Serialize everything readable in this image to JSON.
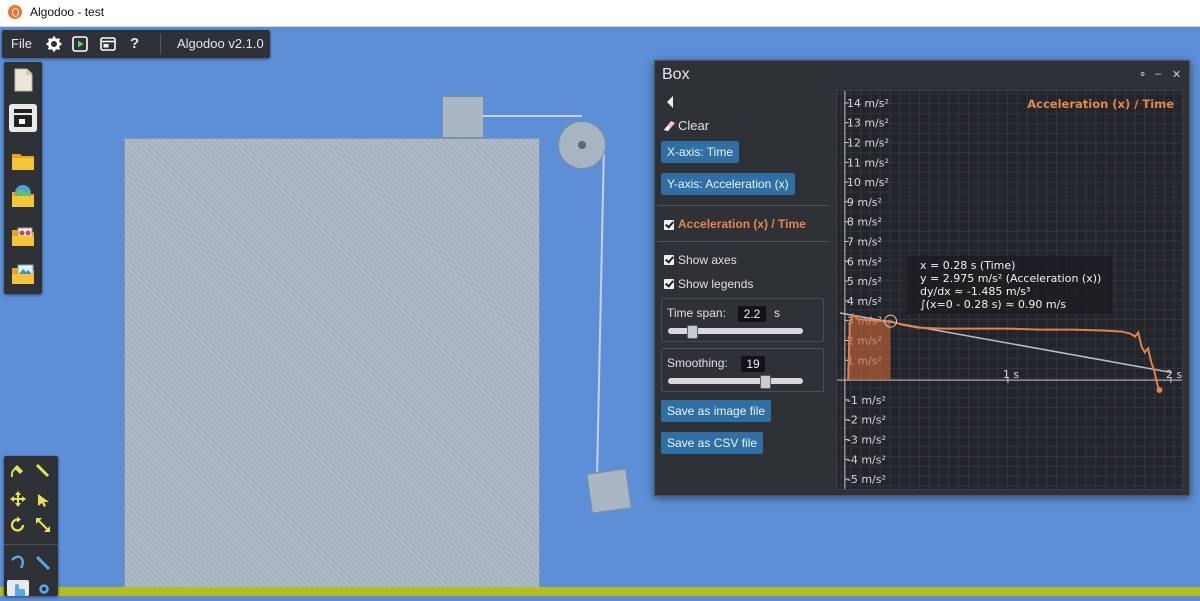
{
  "window": {
    "title": "Algodoo - test"
  },
  "menubar": {
    "file_label": "File",
    "version": "Algodoo v2.1.0",
    "help_label": "?"
  },
  "panel": {
    "title": "Box",
    "clear_label": "Clear",
    "x_axis_button": "X-axis: Time",
    "y_axis_button": "Y-axis: Acceleration (x)",
    "series_label": "Acceleration (x) / Time",
    "show_axes_label": "Show axes",
    "show_legends_label": "Show legends",
    "time_span_label": "Time span:",
    "time_span_value": "2.2",
    "time_span_unit": "s",
    "time_span_fraction": 0.18,
    "smoothing_label": "Smoothing:",
    "smoothing_value": "19",
    "smoothing_fraction": 0.72,
    "save_image_label": "Save as image file",
    "save_csv_label": "Save as CSV file"
  },
  "chart_data": {
    "type": "line",
    "title": "Acceleration (x) / Time",
    "y_tick_labels": [
      "14 m/s²",
      "13 m/s²",
      "12 m/s²",
      "11 m/s²",
      "10 m/s²",
      "9 m/s²",
      "8 m/s²",
      "7 m/s²",
      "6 m/s²",
      "5 m/s²",
      "4 m/s²",
      "3 m/s²",
      "2 m/s²",
      "1 m/s²",
      "-1 m/s²",
      "-2 m/s²",
      "-3 m/s²",
      "-4 m/s²",
      "-5 m/s²"
    ],
    "y_ticks": [
      14,
      13,
      12,
      11,
      10,
      9,
      8,
      7,
      6,
      5,
      4,
      3,
      2,
      1,
      -1,
      -2,
      -3,
      -4,
      -5
    ],
    "x_tick_labels": [
      "1 s",
      "2 s"
    ],
    "x_ticks": [
      1,
      2
    ],
    "xlim": [
      -0.03,
      2.05
    ],
    "ylim": [
      -5.5,
      14.6
    ],
    "series": [
      {
        "color": "#e0824a",
        "x": [
          0.02,
          0.03,
          0.05,
          0.08,
          0.12,
          0.18,
          0.24,
          0.28,
          0.35,
          0.45,
          0.6,
          0.8,
          1.0,
          1.2,
          1.4,
          1.6,
          1.7,
          1.75,
          1.78,
          1.8,
          1.82,
          1.84,
          1.86,
          1.88,
          1.9,
          1.92,
          1.93
        ],
        "y": [
          0.0,
          2.9,
          3.3,
          3.1,
          3.05,
          3.0,
          2.98,
          2.975,
          2.8,
          2.65,
          2.6,
          2.6,
          2.6,
          2.55,
          2.55,
          2.5,
          2.45,
          2.35,
          2.2,
          2.4,
          1.7,
          1.4,
          1.6,
          0.9,
          0.4,
          -0.3,
          -0.5
        ]
      },
      {
        "color": "#b8bcc4",
        "x": [
          -0.03,
          2.0
        ],
        "y": [
          3.39,
          0.39
        ]
      }
    ],
    "shaded_area": {
      "x_from": 0,
      "x_to": 0.28,
      "color": "#c0643a"
    },
    "cursor_point": {
      "x": 0.28,
      "y": 2.975
    },
    "readout": [
      "x = 0.28 s (Time)",
      "y = 2.975 m/s² (Acceleration (x))",
      "dy/dx ≈ -1.485 m/s³",
      "∫(x=0 - 0.28 s) ≈ 0.90 m/s"
    ],
    "grid": true,
    "legend": "top-right"
  }
}
